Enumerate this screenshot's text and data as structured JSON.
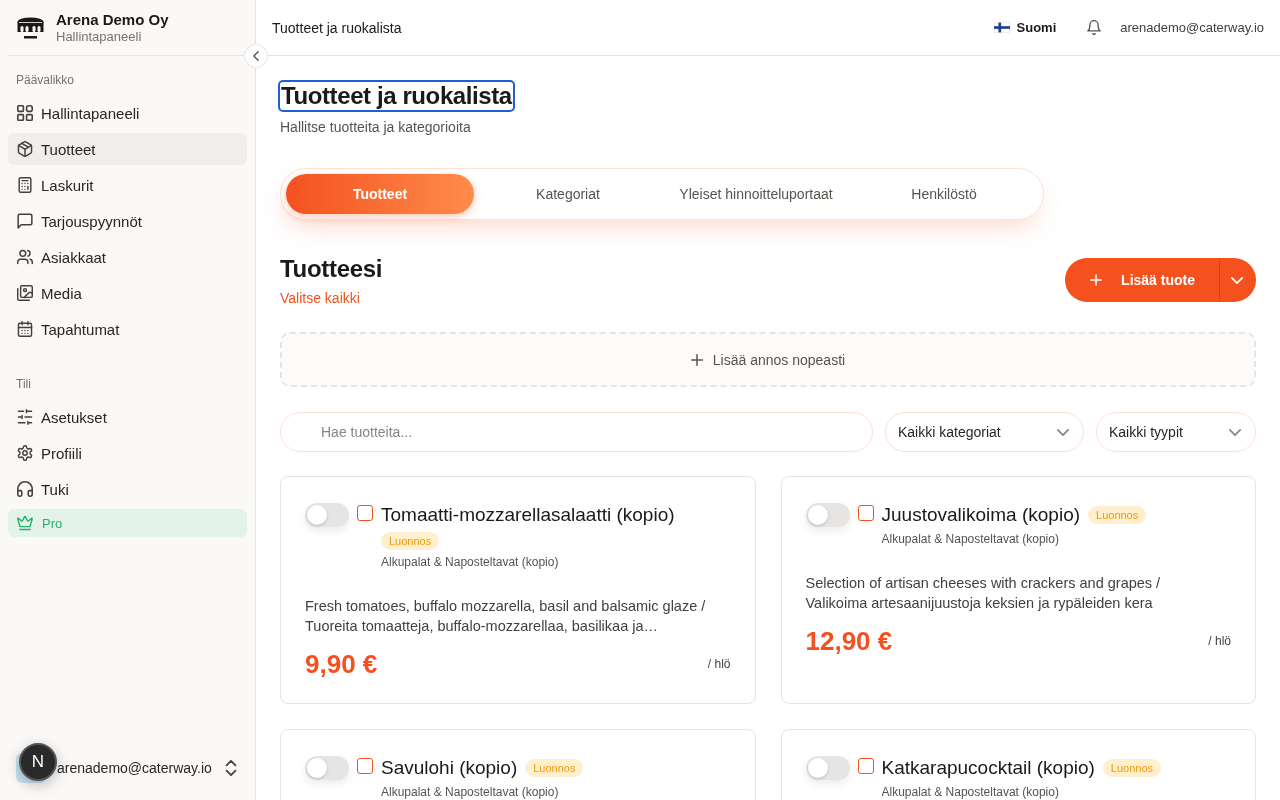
{
  "sidebar": {
    "brand": {
      "name": "Arena Demo Oy",
      "subtitle": "Hallintapaneeli"
    },
    "sections": [
      {
        "heading": "Päävalikko",
        "items": [
          {
            "label": "Hallintapaneeli",
            "kind": "link",
            "selected": false
          },
          {
            "label": "Tuotteet",
            "kind": "link",
            "selected": true
          },
          {
            "label": "Laskurit",
            "kind": "link",
            "selected": false
          },
          {
            "label": "Tarjouspyynnöt",
            "kind": "link",
            "selected": false
          },
          {
            "label": "Asiakkaat",
            "kind": "link",
            "selected": false
          },
          {
            "label": "Media",
            "kind": "link",
            "selected": false
          },
          {
            "label": "Tapahtumat",
            "kind": "link",
            "selected": false
          }
        ]
      },
      {
        "heading": "Tili",
        "items": [
          {
            "label": "Asetukset",
            "kind": "link",
            "selected": false
          },
          {
            "label": "Profiili",
            "kind": "link",
            "selected": false
          },
          {
            "label": "Tuki",
            "kind": "link",
            "selected": false
          },
          {
            "label": "Pro",
            "kind": "upgrade",
            "selected": false
          }
        ]
      }
    ],
    "user": {
      "email": "arenademo@caterway.io"
    }
  },
  "dev_badge": {
    "label": "N"
  },
  "top_bar": {
    "title": "Tuotteet ja ruokalista",
    "language": "Suomi",
    "email": "arenademo@caterway.io"
  },
  "page_header": {
    "title": "Tuotteet ja ruokalista",
    "focused": true,
    "subtitle": "Hallitse tuotteita ja kategorioita"
  },
  "tabs": [
    {
      "label": "Tuotteet",
      "selected": true
    },
    {
      "label": "Kategoriat",
      "selected": false
    },
    {
      "label": "Yleiset hinnoitteluportaat",
      "selected": false
    },
    {
      "label": "Henkilöstö",
      "selected": false
    }
  ],
  "products_header": {
    "title": "Tuotteesi",
    "select_all": "Valitse kaikki",
    "add_button": "Lisää tuote"
  },
  "quick_add": {
    "label": "Lisää annos nopeasti"
  },
  "filters": {
    "search": {
      "placeholder": "Hae tuotteita..."
    },
    "category": "Kaikki kategoriat",
    "type": "Kaikki tyypit"
  },
  "products": [
    {
      "name": "Tomaatti-mozzarellasalaatti (kopio)",
      "status": "Luonnos",
      "category": "Alkupalat & Naposteltavat (kopio)",
      "description": "Fresh tomatoes, buffalo mozzarella, basil and balsamic glaze / Tuoreita tomaatteja, buffalo-mozzarellaa, basilikaa ja…",
      "price": "9,90 €",
      "unit": "/ hlö",
      "active": false,
      "checked": false
    },
    {
      "name": "Juustovalikoima (kopio)",
      "status": "Luonnos",
      "category": "Alkupalat & Naposteltavat (kopio)",
      "description": "Selection of artisan cheeses with crackers and grapes / Valikoima artesaanijuustoja keksien ja rypäleiden kera",
      "price": "12,90 €",
      "unit": "/ hlö",
      "active": false,
      "checked": false
    },
    {
      "name": "Savulohi (kopio)",
      "status": "Luonnos",
      "category": "Alkupalat & Naposteltavat (kopio)",
      "active": false,
      "checked": false
    },
    {
      "name": "Katkarapucocktail (kopio)",
      "status": "Luonnos",
      "category": "Alkupalat & Naposteltavat (kopio)",
      "active": false,
      "checked": false
    }
  ]
}
